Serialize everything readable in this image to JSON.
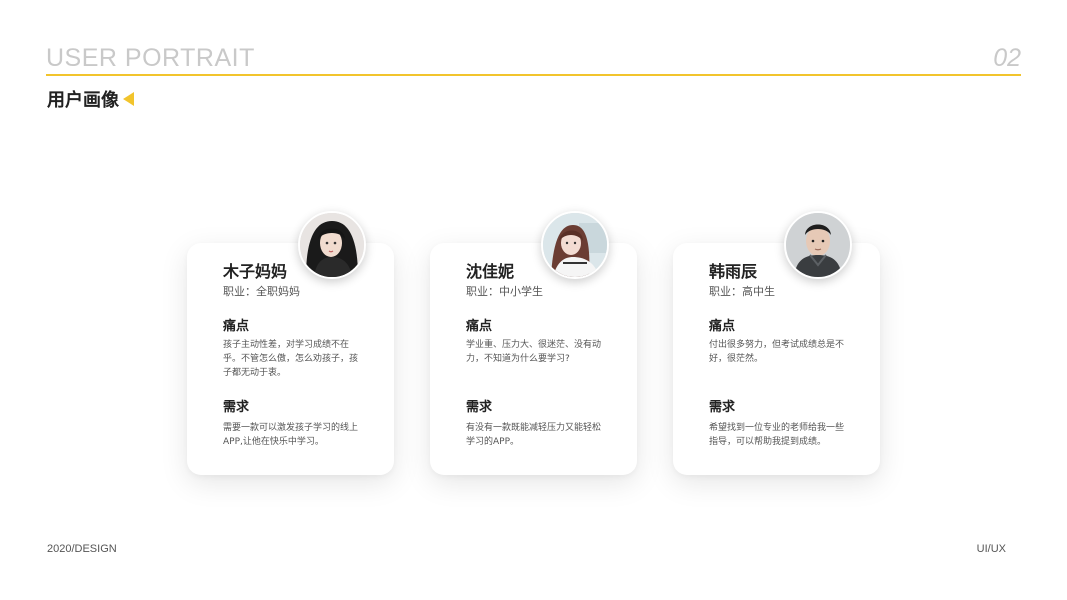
{
  "header": {
    "title": "USER PORTRAIT",
    "number": "02",
    "subtitle": "用户画像",
    "accent_color": "#f2c42c"
  },
  "cards": [
    {
      "name": "木子妈妈",
      "job": "职业：全职妈妈",
      "pain_title": "痛点",
      "pain_text": "孩子主动性差，对学习成绩不在乎。不管怎么傲，怎么劝孩子，孩子都无动于衷。",
      "need_title": "需求",
      "need_text": "需要一款可以激发孩子学习的线上APP,让他在快乐中学习。"
    },
    {
      "name": "沈佳妮",
      "job": "职业：中小学生",
      "pain_title": "痛点",
      "pain_text": "学业重、压力大、很迷茫、没有动力，不知道为什么要学习?",
      "need_title": "需求",
      "need_text": "有没有一款既能减轻压力又能轻松学习的APP。"
    },
    {
      "name": "韩雨辰",
      "job": "职业：高中生",
      "pain_title": "痛点",
      "pain_text": "付出很多努力，但考试成绩总是不好，很茫然。",
      "need_title": "需求",
      "need_text": "希望找到一位专业的老师给我一些指导，可以帮助我提到成绩。"
    }
  ],
  "footer": {
    "left": "2020/DESIGN",
    "right": "UI/UX"
  }
}
